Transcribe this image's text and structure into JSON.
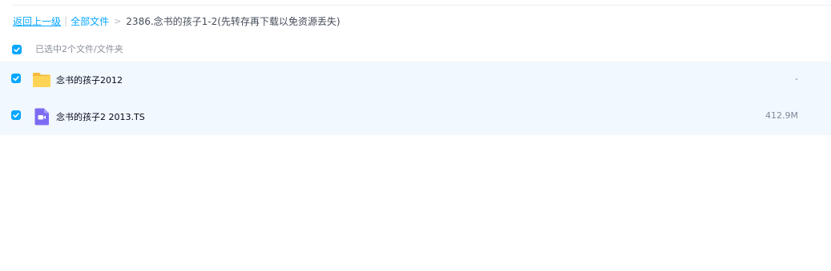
{
  "breadcrumb": {
    "back_label": "返回上一级",
    "separator": "|",
    "all_files_label": "全部文件",
    "arrow": ">",
    "current_folder": "2386.念书的孩子1-2(先转存再下载以免资源丢失)"
  },
  "selection": {
    "summary": "已选中2个文件/文件夹",
    "checked": true
  },
  "files": [
    {
      "name": "念书的孩子2012",
      "size": "-",
      "type": "folder-icon",
      "checked": true
    },
    {
      "name": "念书的孩子2 2013.TS",
      "size": "412.9M",
      "type": "video-file-icon",
      "checked": true
    }
  ],
  "colors": {
    "accent": "#06a7ff",
    "row_selected_bg": "#f1f8fe",
    "folder_yellow": "#ffc83d",
    "video_purple": "#7c6cf2"
  }
}
